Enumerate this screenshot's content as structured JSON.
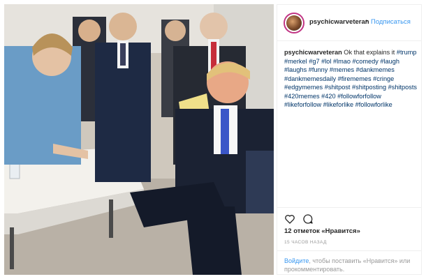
{
  "post": {
    "username": "psychicwarveteran",
    "separator": "•",
    "follow_label": "Подписаться",
    "caption_user": "psychicwarveteran",
    "caption_text": "Ok that explains it",
    "hashtags": "#trump #merkel #g7 #lol #lmao #comedy #laugh #laughs #funny #memes #dankmemes #dankmemesdaily #firememes #cringe #edgymemes #shitpost #shitposting #shitposts #420memes #420 #followforfollow #likeforfollow #likeforlike #followforlike",
    "likes": "12 отметок «Нравится»",
    "time_ago": "15 ЧАСОВ НАЗАД",
    "login_link": "Войдите",
    "login_text": ", чтобы поставить «Нравится» или прокомментировать.",
    "icons": {
      "like": "heart-icon",
      "comment": "comment-icon"
    },
    "colors": {
      "link": "#3897f0",
      "hashtag": "#003569",
      "muted": "#999999",
      "border": "#efefef"
    }
  }
}
